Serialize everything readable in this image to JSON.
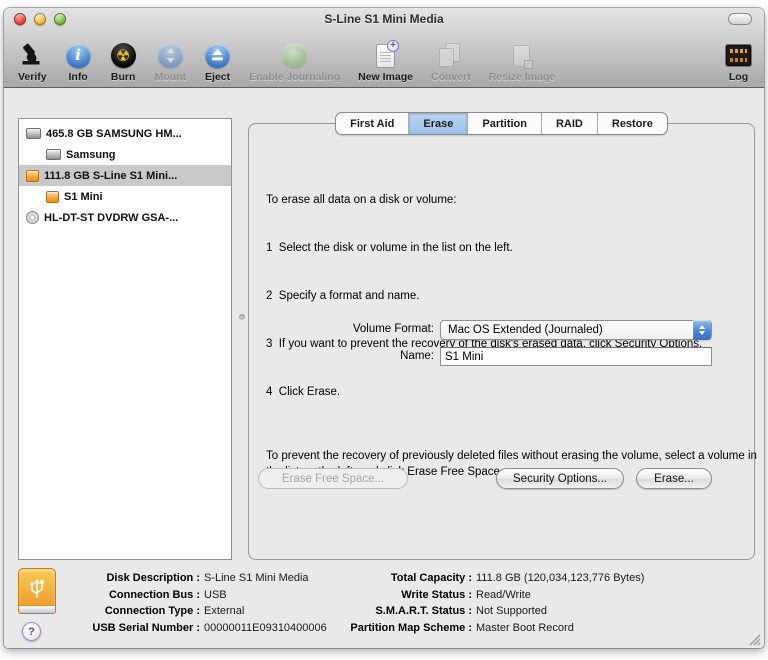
{
  "window": {
    "title": "S-Line S1 Mini Media"
  },
  "toolbar": {
    "items": [
      {
        "label": "Verify",
        "enabled": true
      },
      {
        "label": "Info",
        "enabled": true
      },
      {
        "label": "Burn",
        "enabled": true
      },
      {
        "label": "Mount",
        "enabled": false
      },
      {
        "label": "Eject",
        "enabled": true
      },
      {
        "label": "Enable Journaling",
        "enabled": false
      },
      {
        "label": "New Image",
        "enabled": true
      },
      {
        "label": "Convert",
        "enabled": false
      },
      {
        "label": "Resize Image",
        "enabled": false
      },
      {
        "label": "Log",
        "enabled": true
      }
    ]
  },
  "sidebar": {
    "items": [
      {
        "label": "465.8 GB SAMSUNG HM...",
        "icon": "internal-disk",
        "indent": 0,
        "selected": false
      },
      {
        "label": "Samsung",
        "icon": "internal-disk",
        "indent": 1,
        "selected": false
      },
      {
        "label": "111.8 GB S-Line S1 Mini...",
        "icon": "external-disk",
        "indent": 0,
        "selected": true
      },
      {
        "label": "S1 Mini",
        "icon": "external-disk",
        "indent": 1,
        "selected": false
      },
      {
        "label": "HL-DT-ST DVDRW GSA-...",
        "icon": "optical-drive",
        "indent": 0,
        "selected": false
      }
    ]
  },
  "tabs": {
    "items": [
      {
        "label": "First Aid",
        "selected": false
      },
      {
        "label": "Erase",
        "selected": true
      },
      {
        "label": "Partition",
        "selected": false
      },
      {
        "label": "RAID",
        "selected": false
      },
      {
        "label": "Restore",
        "selected": false
      }
    ]
  },
  "erase": {
    "intro": "To erase all data on a disk or volume:",
    "steps": [
      "1  Select the disk or volume in the list on the left.",
      "2  Specify a format and name.",
      "3  If you want to prevent the recovery of the disk's erased data, click Security Options.",
      "4  Click Erase."
    ],
    "note": "To prevent the recovery of previously deleted files without erasing the volume, select a volume in the list on the left, and click Erase Free Space.",
    "volume_format_label": "Volume Format:",
    "volume_format_value": "Mac OS Extended (Journaled)",
    "name_label": "Name:",
    "name_value": "S1 Mini",
    "erase_free_space_button": "Erase Free Space...",
    "security_options_button": "Security Options...",
    "erase_button": "Erase..."
  },
  "info": {
    "left": [
      {
        "label": "Disk Description :",
        "value": "S-Line S1 Mini Media"
      },
      {
        "label": "Connection Bus :",
        "value": "USB"
      },
      {
        "label": "Connection Type :",
        "value": "External"
      },
      {
        "label": "USB Serial Number :",
        "value": "00000011E09310400006"
      }
    ],
    "right": [
      {
        "label": "Total Capacity :",
        "value": "111.8 GB (120,034,123,776 Bytes)"
      },
      {
        "label": "Write Status :",
        "value": "Read/Write"
      },
      {
        "label": "S.M.A.R.T. Status :",
        "value": "Not Supported"
      },
      {
        "label": "Partition Map Scheme :",
        "value": "Master Boot Record"
      }
    ]
  },
  "help_button_label": "?",
  "colors": {
    "tab_selected": "#a9cbee",
    "selection_gray": "#c9c9c9",
    "accent_orange": "#f3a93f"
  }
}
